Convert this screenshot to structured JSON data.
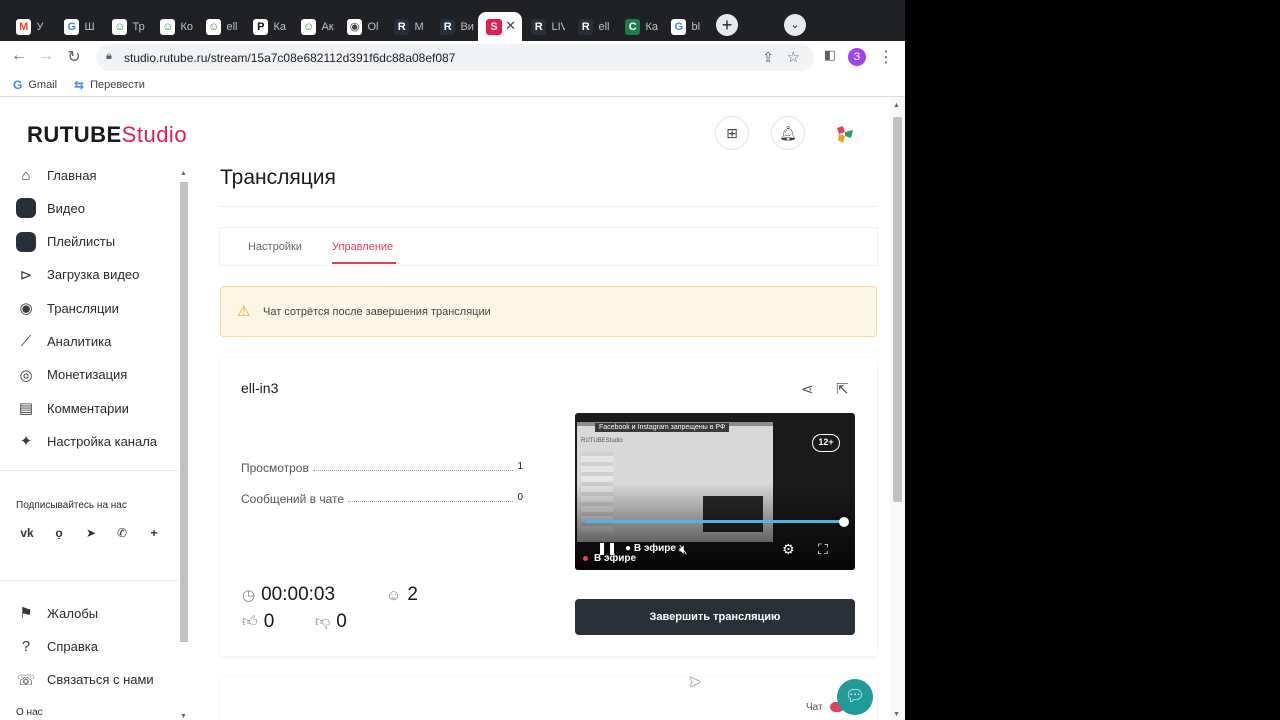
{
  "browser": {
    "tabs": [
      {
        "icon": "gmail-icon",
        "short": "M",
        "title": "У",
        "color": "#ea4335",
        "bg": "#fff"
      },
      {
        "icon": "web-icon",
        "short": "G",
        "title": "Ш",
        "color": "#4285f4",
        "bg": "#fff"
      },
      {
        "icon": "mask-icon",
        "short": "☺",
        "title": "Тр",
        "color": "#1e8e3e",
        "bg": "#fff"
      },
      {
        "icon": "mask-icon",
        "short": "☺",
        "title": "Ко",
        "color": "#1e8e3e",
        "bg": "#fff"
      },
      {
        "icon": "mask-icon",
        "short": "☺",
        "title": "ell",
        "color": "#1e8e3e",
        "bg": "#fff"
      },
      {
        "icon": "p-icon",
        "short": "P",
        "title": "Ка",
        "color": "#111",
        "bg": "#fff"
      },
      {
        "icon": "mask-icon",
        "short": "☺",
        "title": "Ак",
        "color": "#1e8e3e",
        "bg": "#fff"
      },
      {
        "icon": "eye-icon",
        "short": "◉",
        "title": "Ol",
        "color": "#444",
        "bg": "#fff"
      },
      {
        "icon": "rutube-icon",
        "short": "R",
        "title": "М",
        "color": "#fff",
        "bg": "#27303a"
      },
      {
        "icon": "rutube-icon",
        "short": "R",
        "title": "Ви",
        "color": "#fff",
        "bg": "#27303a"
      },
      {
        "icon": "studio-icon",
        "short": "S",
        "title": "",
        "color": "#fff",
        "bg": "#e31e4f"
      },
      {
        "icon": "rutube-icon",
        "short": "R",
        "title": "LIV",
        "color": "#fff",
        "bg": "#27303a"
      },
      {
        "icon": "rutube-icon",
        "short": "R",
        "title": "ell",
        "color": "#fff",
        "bg": "#27303a"
      },
      {
        "icon": "chat-icon",
        "short": "C",
        "title": "Ка",
        "color": "#fff",
        "bg": "#1f7a4d"
      },
      {
        "icon": "google-icon",
        "short": "G",
        "title": "bl",
        "color": "#4285f4",
        "bg": "#fff"
      }
    ],
    "new_tab": "+",
    "tab_menu": "⌄",
    "url": "studio.rutube.ru/stream/15a7c08e682112d391f6dc88a08ef087",
    "profile_initial": "З",
    "bookmarks": [
      {
        "icon": "G",
        "label": "Gmail"
      },
      {
        "icon": "⇆",
        "label": "Перевести"
      }
    ]
  },
  "header": {
    "logo_main": "RUTUBE",
    "logo_studio": "Studio"
  },
  "sidebar": {
    "items": [
      {
        "label": "Главная",
        "icon": "home-icon",
        "glyph": "⌂",
        "square": false
      },
      {
        "label": "Видео",
        "icon": "video-icon",
        "glyph": "",
        "square": true
      },
      {
        "label": "Плейлисты",
        "icon": "playlist-icon",
        "glyph": "",
        "square": true
      },
      {
        "label": "Загрузка видео",
        "icon": "upload-icon",
        "glyph": "⊳",
        "square": false
      },
      {
        "label": "Трансляции",
        "icon": "broadcast-icon",
        "glyph": "◉",
        "square": false
      },
      {
        "label": "Аналитика",
        "icon": "analytics-icon",
        "glyph": "⟋",
        "square": false
      },
      {
        "label": "Монетизация",
        "icon": "monetization-icon",
        "glyph": "◎",
        "square": false
      },
      {
        "label": "Комментарии",
        "icon": "comments-icon",
        "glyph": "▤",
        "square": false
      },
      {
        "label": "Настройка канала",
        "icon": "wand-icon",
        "glyph": "✦",
        "square": false
      }
    ],
    "follow_label": "Подписывайтесь на нас",
    "socials": [
      {
        "icon": "vk-icon",
        "glyph": "vk"
      },
      {
        "icon": "ok-icon",
        "glyph": "ọ"
      },
      {
        "icon": "telegram-icon",
        "glyph": "➤"
      },
      {
        "icon": "viber-icon",
        "glyph": "✆"
      },
      {
        "icon": "more-icon",
        "glyph": "+"
      }
    ],
    "bottom_items": [
      {
        "label": "Жалобы",
        "icon": "flag-icon",
        "glyph": "⚑"
      },
      {
        "label": "Справка",
        "icon": "help-icon",
        "glyph": "?"
      },
      {
        "label": "Связаться с нами",
        "icon": "support-icon",
        "glyph": "☏"
      }
    ],
    "about_label": "О нас"
  },
  "main": {
    "title": "Трансляция",
    "tabs": [
      {
        "label": "Настройки",
        "active": false
      },
      {
        "label": "Управление",
        "active": true
      }
    ],
    "alert": "Чат сотрётся после завершения трансляции",
    "stream": {
      "name": "ell-in3",
      "stats": [
        {
          "label": "Просмотров",
          "value": "1"
        },
        {
          "label": "Сообщений в чате",
          "value": "0"
        }
      ],
      "duration": "00:00:03",
      "viewers": "2",
      "likes": "0",
      "dislikes": "0",
      "end_button": "Завершить трансляцию"
    },
    "player": {
      "banner": "Facebook и Instagram запрещены в РФ",
      "frame_logo": "RUTUBEStudio",
      "age": "12+",
      "live_control": "● В эфире",
      "live_label": "В эфире",
      "progress": 1.0
    },
    "chat_label": "Чат"
  }
}
